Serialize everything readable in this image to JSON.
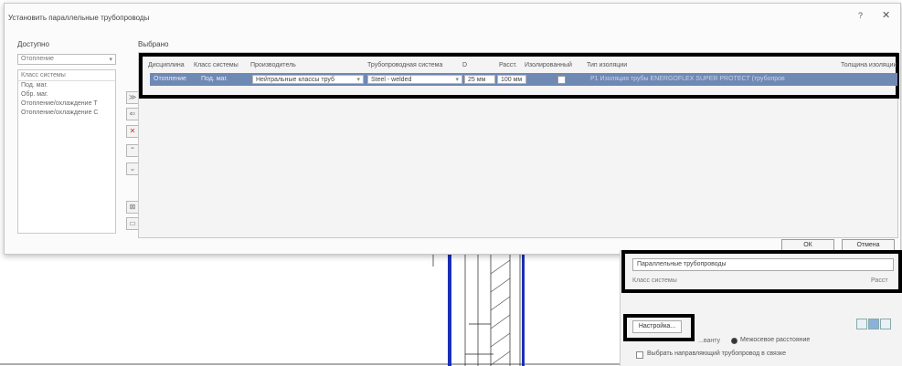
{
  "dialog": {
    "title": "Установить параллельные трубопроводы",
    "help_glyph": "?",
    "close_glyph": "✕",
    "available_label": "Доступно",
    "selected_label": "Выбрано",
    "category_select": "Отопление",
    "available_list_header": "Класс системы",
    "available_items": [
      "Под. маг.",
      "Обр. маг.",
      "Отопление/охлаждение Т",
      "Отопление/охлаждение С"
    ],
    "tool_buttons": [
      "≫",
      "⇐",
      "✕",
      "⌃",
      "⌄",
      "⊠",
      "▭"
    ],
    "grid": {
      "headers": [
        "Дисциплина",
        "Класс системы",
        "Производитель",
        "Трубопроводная система",
        "D",
        "Расст.",
        "Изолированный",
        "Тип изоляции",
        "Толщина изоляции"
      ],
      "row": {
        "discipline": "Отопление",
        "system_class": "Под. маг.",
        "manufacturer": "Нейтральные классы труб",
        "piping_system": "Steel - welded",
        "diameter": "25 мм",
        "spacing": "100 мм",
        "insulation_type": "Р1 Изоляция трубы ENERGOFLEX SUPER PROTECT (трубопров"
      }
    },
    "ok_label": "ОК",
    "cancel_label": "Отмена"
  },
  "panel": {
    "title": "Параллельные трубопроводы",
    "row_label": "Класс системы",
    "row_value": "Расст",
    "settings_button": "Настройка...",
    "by_element_text": "...ванту",
    "spacing_mode": "Межосевое расстояние",
    "guide_checkbox_label": "Выбрать направляющий трубопровод в связке"
  },
  "colors": {
    "row_selected": "#6f89b5",
    "highlight_border": "#000000",
    "pipe_blue": "#1a2fb8"
  }
}
